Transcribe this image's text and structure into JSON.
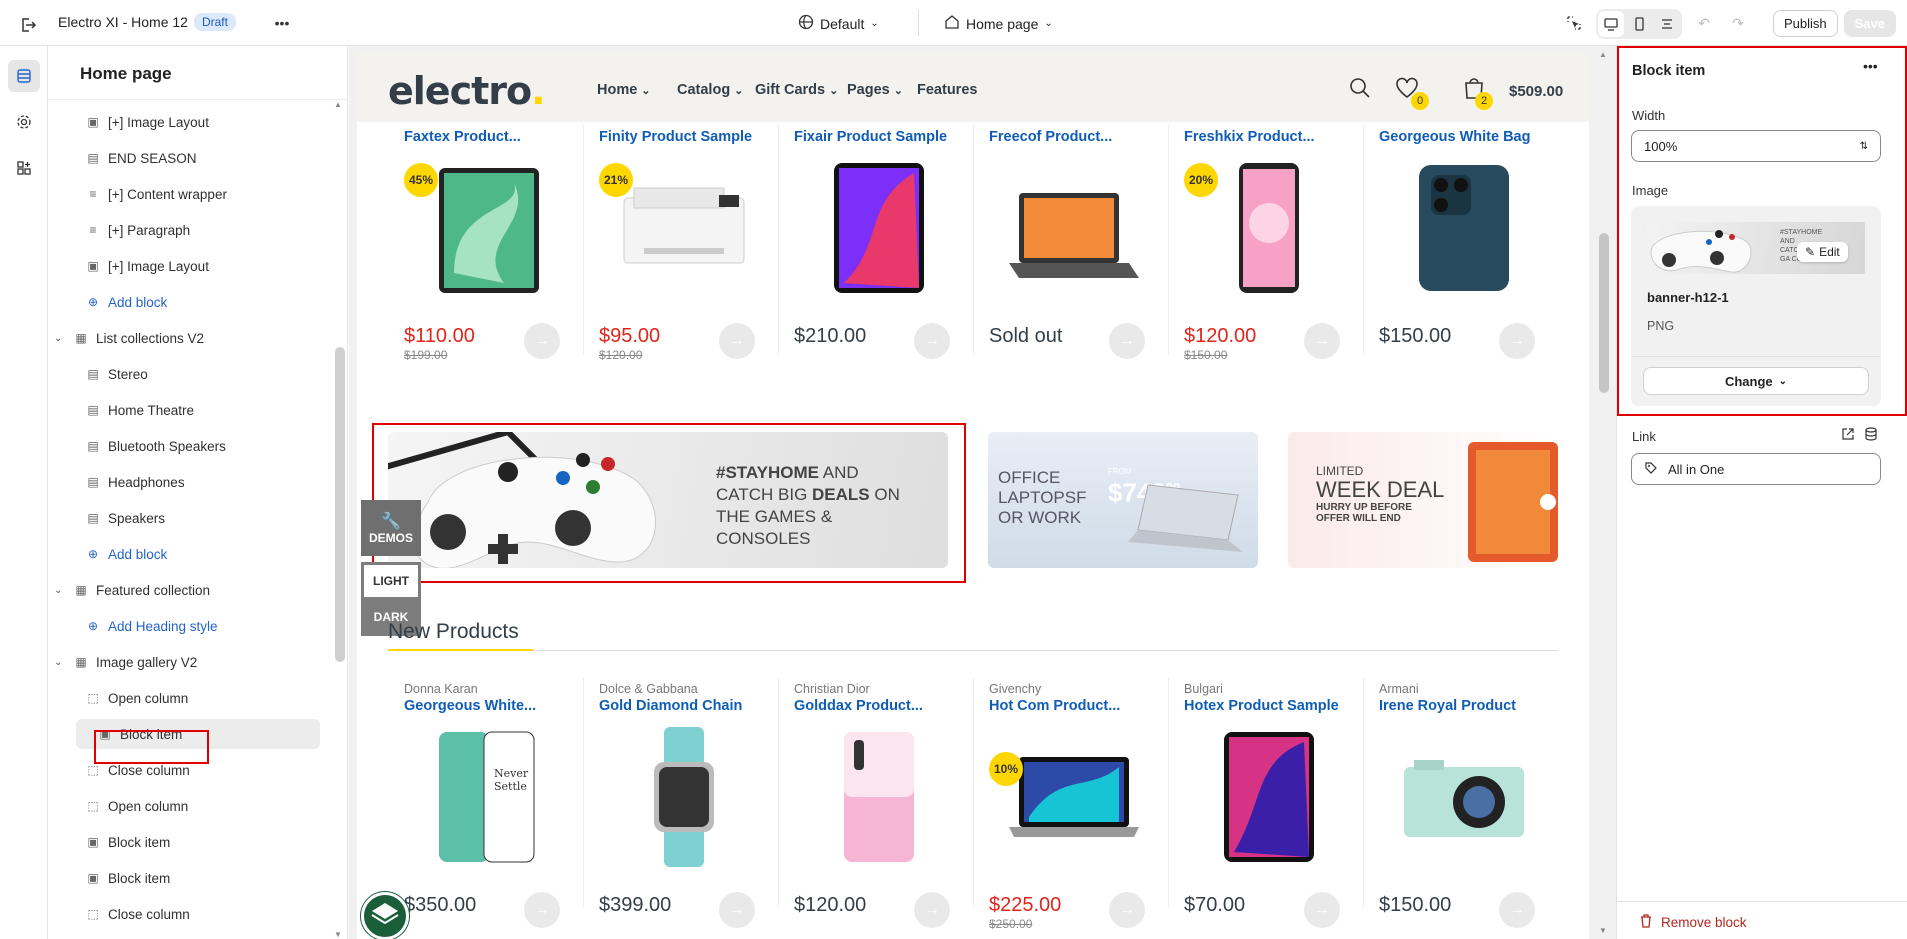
{
  "topbar": {
    "theme_name": "Electro XI - Home 12",
    "status_badge": "Draft",
    "default_selector": "Default",
    "page_selector": "Home page",
    "publish_label": "Publish",
    "save_label": "Save"
  },
  "sidebar": {
    "title": "Home page",
    "items": [
      {
        "label": "[+] Paragraph",
        "icon": "paragraph-icon"
      },
      {
        "label": "[+] Image Layout",
        "icon": "image-icon"
      },
      {
        "label": "END SEASON",
        "icon": "block-icon"
      },
      {
        "label": "[+] Content wrapper",
        "icon": "paragraph-icon"
      },
      {
        "label": "[+] Paragraph",
        "icon": "paragraph-icon"
      },
      {
        "label": "[+] Image Layout",
        "icon": "image-icon"
      },
      {
        "label": "Add block",
        "icon": "plus-circle-icon"
      },
      {
        "label": "List collections V2",
        "icon": "section-icon"
      },
      {
        "label": "Stereo",
        "icon": "block-icon"
      },
      {
        "label": "Home Theatre",
        "icon": "block-icon"
      },
      {
        "label": "Bluetooth Speakers",
        "icon": "block-icon"
      },
      {
        "label": "Headphones",
        "icon": "block-icon"
      },
      {
        "label": "Speakers",
        "icon": "block-icon"
      },
      {
        "label": "Add block",
        "icon": "plus-circle-icon"
      },
      {
        "label": "Featured collection",
        "icon": "section-icon"
      },
      {
        "label": "Add Heading style",
        "icon": "plus-circle-icon"
      },
      {
        "label": "Image gallery V2",
        "icon": "section-icon"
      },
      {
        "label": "Open column",
        "icon": "column-icon"
      },
      {
        "label": "Block item",
        "icon": "image-icon"
      },
      {
        "label": "Close column",
        "icon": "column-icon"
      },
      {
        "label": "Open column",
        "icon": "column-icon"
      },
      {
        "label": "Block item",
        "icon": "image-icon"
      },
      {
        "label": "Block item",
        "icon": "image-icon"
      },
      {
        "label": "Close column",
        "icon": "column-icon"
      }
    ]
  },
  "store": {
    "logo": "electro",
    "nav": [
      "Home",
      "Catalog",
      "Gift Cards",
      "Pages",
      "Features"
    ],
    "wishlist_count": "0",
    "cart_count": "2",
    "cart_total": "$509.00",
    "products_row1": [
      {
        "name": "Faxtex Product...",
        "price": "$110.00",
        "old": "$199.00",
        "discount": "45%",
        "sale": true
      },
      {
        "name": "Finity Product Sample",
        "price": "$95.00",
        "old": "$120.00",
        "discount": "21%",
        "sale": true
      },
      {
        "name": "Fixair Product Sample",
        "price": "$210.00",
        "old": "",
        "discount": "",
        "sale": false
      },
      {
        "name": "Freecof Product...",
        "price": "Sold out",
        "old": "",
        "discount": "",
        "sale": false
      },
      {
        "name": "Freshkix Product...",
        "price": "$120.00",
        "old": "$150.00",
        "discount": "20%",
        "sale": true
      },
      {
        "name": "Georgeous White Bag",
        "price": "$150.00",
        "old": "",
        "discount": "",
        "sale": false
      }
    ],
    "banner1": {
      "hashtag": "#STAYHOME",
      "line1": " AND",
      "line2a": "CATCH BIG ",
      "line2b": "DEALS",
      "line2c": " ON",
      "line3": "THE GAMES &",
      "line4": "CONSOLES"
    },
    "banner2": {
      "line1": "OFFICE",
      "line2": "LAPTOPSF",
      "line3": "OR WORK",
      "from": "FROM",
      "price": "$749",
      "cents": "99"
    },
    "banner3": {
      "line1": "LIMITED",
      "line2": "WEEK DEAL",
      "line3": "HURRY UP BEFORE",
      "line4": "OFFER WILL END"
    },
    "demos_label": "DEMOS",
    "light_label": "LIGHT",
    "dark_label": "DARK",
    "new_products_title": "New Products",
    "products_row2": [
      {
        "brand": "Donna Karan",
        "name": "Georgeous White...",
        "price": "$350.00",
        "old": "",
        "discount": "",
        "sale": false
      },
      {
        "brand": "Dolce & Gabbana",
        "name": "Gold Diamond Chain",
        "price": "$399.00",
        "old": "",
        "discount": "",
        "sale": false
      },
      {
        "brand": "Christian Dior",
        "name": "Golddax Product...",
        "price": "$120.00",
        "old": "",
        "discount": "",
        "sale": false
      },
      {
        "brand": "Givenchy",
        "name": "Hot Com Product...",
        "price": "$225.00",
        "old": "$250.00",
        "discount": "10%",
        "sale": true
      },
      {
        "brand": "Bulgari",
        "name": "Hotex Product Sample",
        "price": "$70.00",
        "old": "",
        "discount": "",
        "sale": false
      },
      {
        "brand": "Armani",
        "name": "Irene Royal Product",
        "price": "$150.00",
        "old": "",
        "discount": "",
        "sale": false
      }
    ]
  },
  "panel": {
    "title": "Block item",
    "width_label": "Width",
    "width_value": "100%",
    "image_label": "Image",
    "image_name": "banner-h12-1",
    "image_type": "PNG",
    "edit_label": "Edit",
    "change_label": "Change",
    "link_label": "Link",
    "link_value": "All in One",
    "remove_label": "Remove block",
    "thumb_text": "#STAYHOME AND CATCH THE GA CONSC"
  },
  "colors": {
    "accent": "#fed700",
    "link": "#0f5db5",
    "sale": "#e1251b",
    "selection": "#e00000"
  }
}
